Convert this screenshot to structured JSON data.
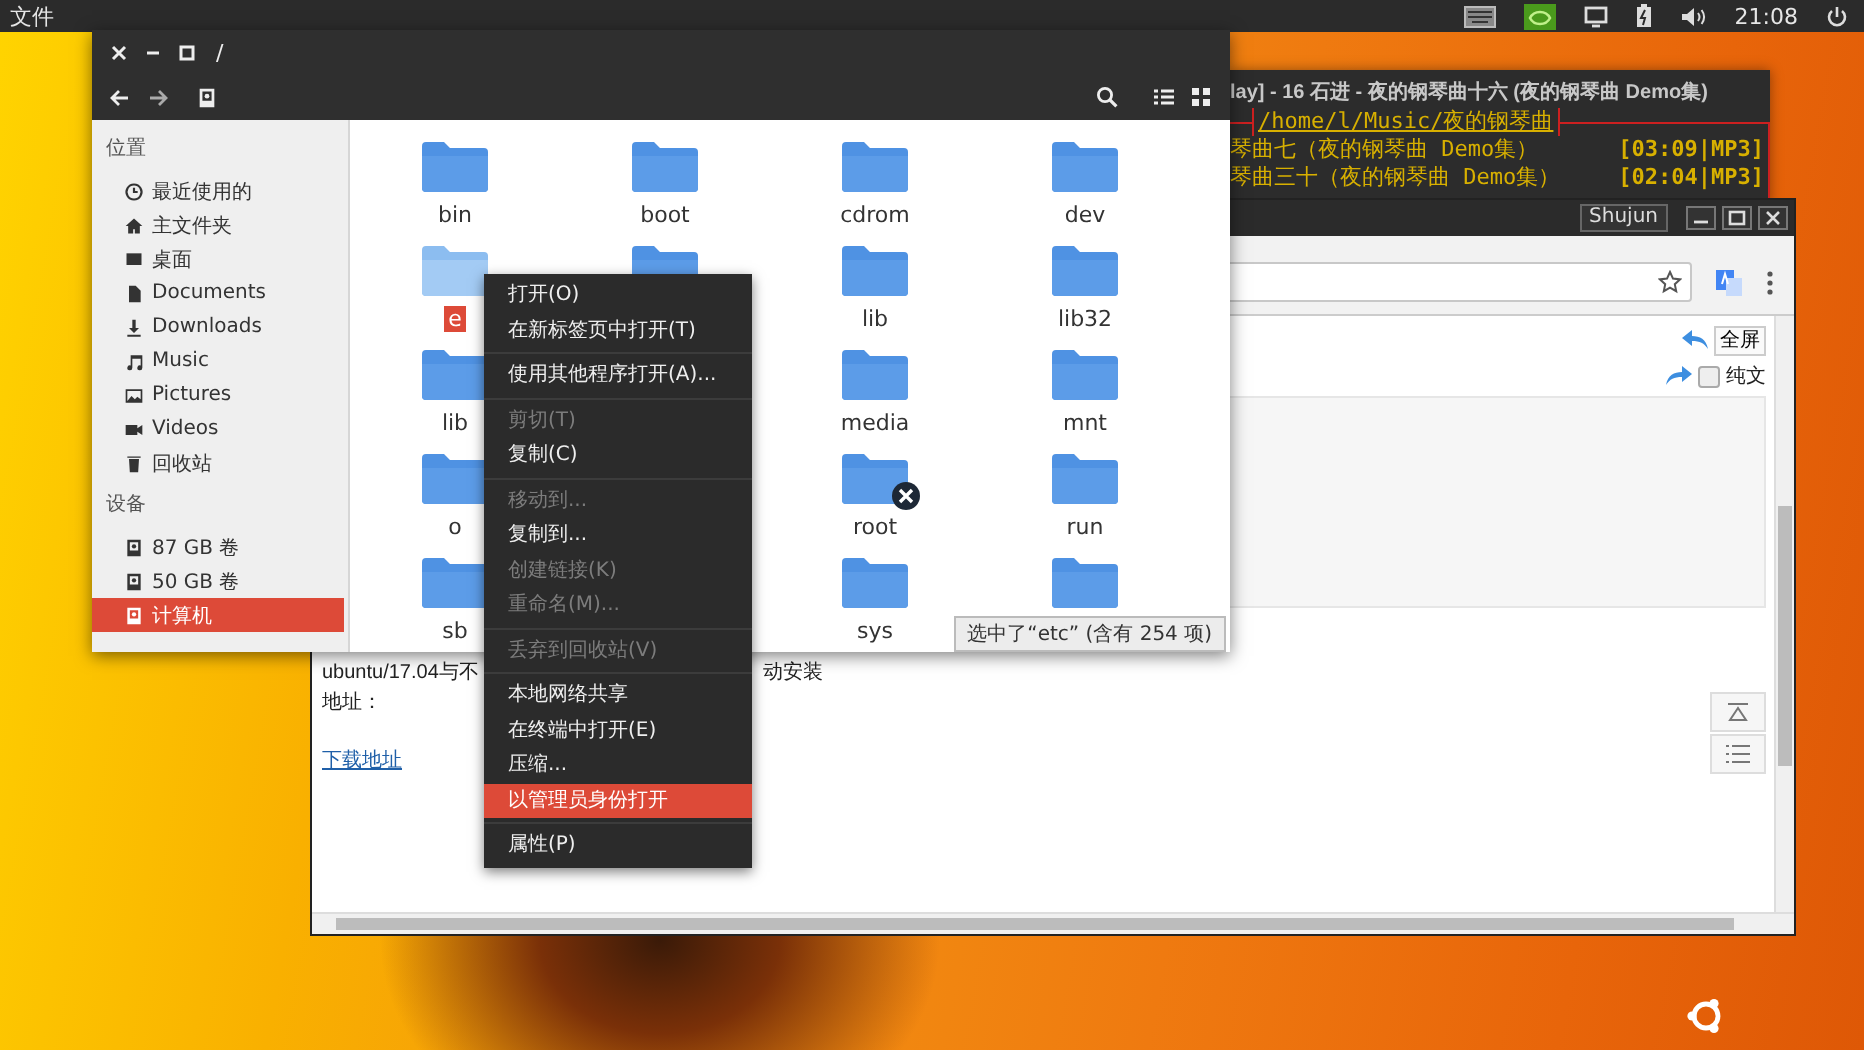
{
  "top_bar": {
    "menu": "文件",
    "clock": "21:08"
  },
  "music_terminal": {
    "title": "lay] - 16 石进 - 夜的钢琴曲十六 (夜的钢琴曲 Demo集)",
    "path": "/home/l/Music/夜的钢琴曲",
    "tracks": [
      {
        "title": "琴曲七（夜的钢琴曲 Demo集）",
        "info": "[03:09|MP3]"
      },
      {
        "title": "琴曲三十（夜的钢琴曲 Demo集）",
        "info": "[02:04|MP3]"
      }
    ]
  },
  "browser": {
    "profile": "Shujun",
    "fullscreen_button": "全屏",
    "plain_text_option": {
      "label": "纯文",
      "checked": false
    },
    "article": {
      "line_start": "ubuntu/17.04与不",
      "line_end": "动安装",
      "address_label": "地址：",
      "download_link": "下载地址"
    }
  },
  "file_manager": {
    "title": "/",
    "sidebar": [
      {
        "title": "位置",
        "items": [
          {
            "label": "最近使用的",
            "selected": false
          },
          {
            "label": "主文件夹",
            "selected": false
          },
          {
            "label": "桌面",
            "selected": false
          },
          {
            "label": "Documents",
            "selected": false
          },
          {
            "label": "Downloads",
            "selected": false
          },
          {
            "label": "Music",
            "selected": false
          },
          {
            "label": "Pictures",
            "selected": false
          },
          {
            "label": "Videos",
            "selected": false
          },
          {
            "label": "回收站",
            "selected": false
          }
        ]
      },
      {
        "title": "设备",
        "items": [
          {
            "label": "87 GB 卷",
            "selected": false
          },
          {
            "label": "50 GB 卷",
            "selected": false
          },
          {
            "label": "计算机",
            "selected": true
          }
        ]
      }
    ],
    "folder_columns": [
      {
        "folders": [
          {
            "label": "bin",
            "selected": false,
            "restricted": false
          },
          {
            "label": "e",
            "selected": true,
            "restricted": false
          },
          {
            "label": "lib",
            "selected": false,
            "restricted": false
          },
          {
            "label": "o",
            "selected": false,
            "restricted": false
          },
          {
            "label": "sb",
            "selected": false,
            "restricted": false
          }
        ]
      },
      {
        "folders": [
          {
            "label": "boot",
            "selected": false,
            "restricted": false
          },
          {
            "selected": false,
            "restricted": false
          }
        ]
      },
      {
        "folders": [
          {
            "label": "cdrom",
            "selected": false,
            "restricted": false
          },
          {
            "label": "lib",
            "selected": false,
            "restricted": false
          },
          {
            "label": "media",
            "selected": false,
            "restricted": false
          },
          {
            "label": "root",
            "selected": false,
            "restricted": true
          },
          {
            "label": "sys",
            "selected": false,
            "restricted": false
          }
        ]
      },
      {
        "folders": [
          {
            "label": "dev",
            "selected": false,
            "restricted": false
          },
          {
            "label": "lib32",
            "selected": false,
            "restricted": false
          },
          {
            "label": "mnt",
            "selected": false,
            "restricted": false
          },
          {
            "label": "run",
            "selected": false,
            "restricted": false
          },
          {
            "selected": false,
            "restricted": false
          }
        ]
      }
    ],
    "status": "选中了“etc” (含有 254 项)"
  },
  "context_menu": [
    {
      "kind": "item",
      "label": "打开(O)",
      "disabled": false,
      "selected": false
    },
    {
      "kind": "item",
      "label": "在新标签页中打开(T)",
      "disabled": false,
      "selected": false
    },
    {
      "kind": "separator"
    },
    {
      "kind": "item",
      "label": "使用其他程序打开(A)...",
      "disabled": false,
      "selected": false
    },
    {
      "kind": "separator"
    },
    {
      "kind": "item",
      "label": "剪切(T)",
      "disabled": true,
      "selected": false
    },
    {
      "kind": "item",
      "label": "复制(C)",
      "disabled": false,
      "selected": false
    },
    {
      "kind": "separator"
    },
    {
      "kind": "item",
      "label": "移动到...",
      "disabled": true,
      "selected": false
    },
    {
      "kind": "item",
      "label": "复制到...",
      "disabled": false,
      "selected": false
    },
    {
      "kind": "item",
      "label": "创建链接(K)",
      "disabled": true,
      "selected": false
    },
    {
      "kind": "item",
      "label": "重命名(M)...",
      "disabled": true,
      "selected": false
    },
    {
      "kind": "separator"
    },
    {
      "kind": "item",
      "label": "丢弃到回收站(V)",
      "disabled": true,
      "selected": false
    },
    {
      "kind": "separator"
    },
    {
      "kind": "item",
      "label": "本地网络共享",
      "disabled": false,
      "selected": false
    },
    {
      "kind": "item",
      "label": "在终端中打开(E)",
      "disabled": false,
      "selected": false
    },
    {
      "kind": "item",
      "label": "压缩...",
      "disabled": false,
      "selected": false
    },
    {
      "kind": "item",
      "label": "以管理员身份打开",
      "disabled": false,
      "selected": true
    },
    {
      "kind": "separator"
    },
    {
      "kind": "item",
      "label": "属性(P)",
      "disabled": false,
      "selected": false
    }
  ]
}
